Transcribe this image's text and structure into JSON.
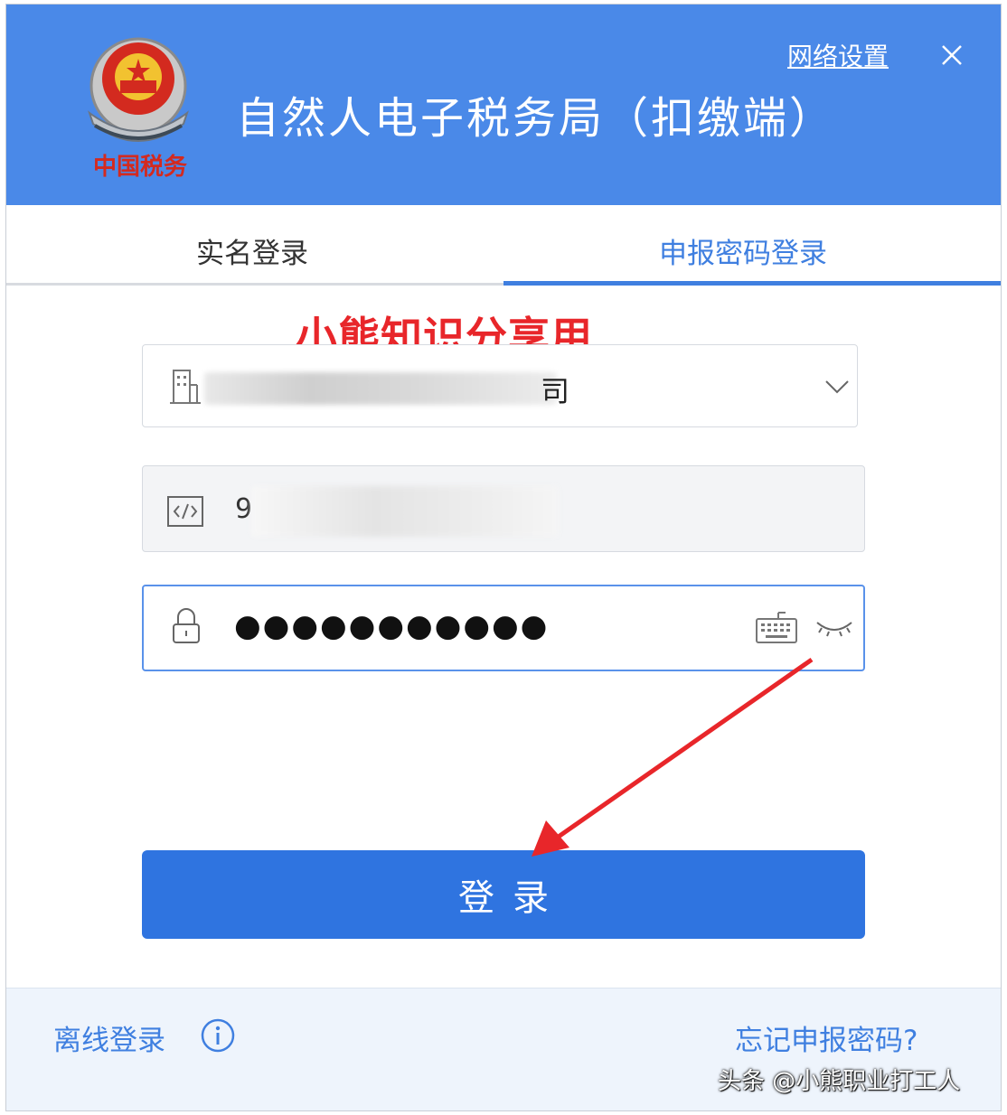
{
  "header": {
    "title": "自然人电子税务局（扣缴端）",
    "network_settings": "网络设置",
    "emblem_text": "中国税务",
    "close_icon": "close-icon",
    "background_color": "#4a89e8"
  },
  "tabs": [
    {
      "label": "实名登录",
      "active": false
    },
    {
      "label": "申报密码登录",
      "active": true
    }
  ],
  "overlay_watermark": "小熊知识分享用",
  "form": {
    "company": {
      "value_visible_prefix": "",
      "value_visible_suffix": "司",
      "icon": "building-icon",
      "dropdown_icon": "chevron-down-icon"
    },
    "tax_id": {
      "value_visible": "9",
      "icon": "code-icon"
    },
    "password": {
      "value_masked": "●●●●●●●●●●●",
      "icon": "lock-icon",
      "keyboard_icon": "keyboard-icon",
      "toggle_icon": "eye-closed-icon"
    }
  },
  "login_button": "登录",
  "footer": {
    "offline_login": "离线登录",
    "info_icon": "info-icon",
    "forgot_password": "忘记申报密码?"
  },
  "attribution": "头条 @小熊职业打工人",
  "colors": {
    "accent": "#3f7fe0",
    "button": "#2f74e0",
    "annotation_red": "#e8262a"
  }
}
